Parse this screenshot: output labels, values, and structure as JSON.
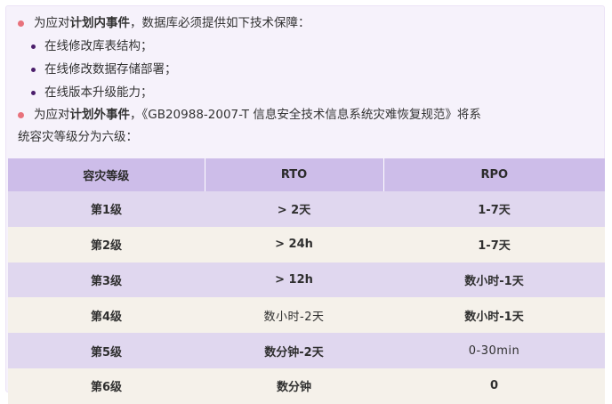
{
  "intro": {
    "line1_pre": "为应对",
    "line1_bold": "计划内事件",
    "line1_post": "，数据库必须提供如下技术保障：",
    "sub_items": [
      "在线修改库表结构；",
      "在线修改数据存储部署；",
      "在线版本升级能力；"
    ],
    "line2_pre": "为应对",
    "line2_bold": "计划外事件",
    "line2_post": "，《GB20988-2007-T 信息安全技术信息系统灾难恢复规范》将系",
    "line3": "统容灾等级分为六级："
  },
  "table": {
    "headers": [
      "容灾等级",
      "RTO",
      "RPO"
    ],
    "rows": [
      [
        "第1级",
        "> 2天",
        "1-7天"
      ],
      [
        "第2级",
        "> 24h",
        "1-7天"
      ],
      [
        "第3级",
        "> 12h",
        "数小时-1天"
      ],
      [
        "第4级",
        "数小时-2天",
        "数小时-1天"
      ],
      [
        "第5级",
        "数分钟-2天",
        "0-30min"
      ],
      [
        "第6级",
        "数分钟",
        "0"
      ]
    ]
  },
  "colors": {
    "card_bg": "#f6f2fb",
    "header_bg": "#cdbde9",
    "row_odd": "#e0d7ef",
    "row_even": "#f5f1ea",
    "bullet_red": "#e8727c",
    "bullet_purple": "#4b1e6b"
  }
}
